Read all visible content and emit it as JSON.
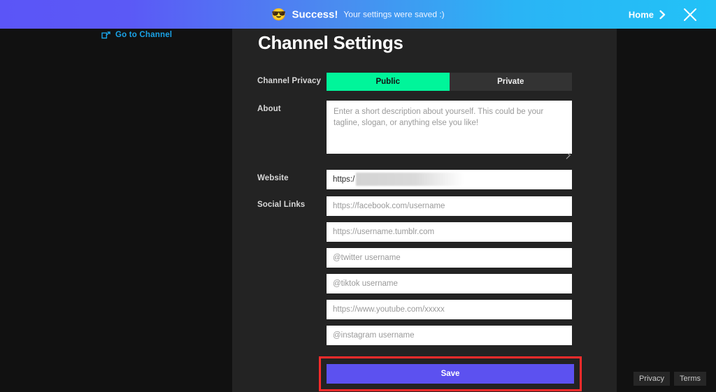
{
  "banner": {
    "emoji": "😎",
    "emoji_name": "sunglasses-face-emoji",
    "strong": "Success!",
    "message": "Your settings were saved :)",
    "home_label": "Home",
    "close_label": "Close",
    "gradient_start": "#5b55f7",
    "gradient_end": "#22c2f7"
  },
  "nav": {
    "go_to_channel": "Go to Channel",
    "link_color": "#1aa3e8"
  },
  "page": {
    "title": "Channel Settings",
    "panel_bg": "#232323",
    "app_bg": "#111111"
  },
  "form": {
    "privacy": {
      "label": "Channel Privacy",
      "options": [
        "Public",
        "Private"
      ],
      "selected": "Public",
      "active_color": "#00f59a",
      "inactive_color": "#333333"
    },
    "about": {
      "label": "About",
      "value": "",
      "placeholder": "Enter a short description about yourself. This could be your tagline, slogan, or anything else you like!"
    },
    "website": {
      "label": "Website",
      "value": "https:/",
      "redacted": true
    },
    "social": {
      "label": "Social Links",
      "fields": [
        {
          "name": "facebook",
          "value": "",
          "placeholder": "https://facebook.com/username"
        },
        {
          "name": "tumblr",
          "value": "",
          "placeholder": "https://username.tumblr.com"
        },
        {
          "name": "twitter",
          "value": "",
          "placeholder": "@twitter username"
        },
        {
          "name": "tiktok",
          "value": "",
          "placeholder": "@tiktok username"
        },
        {
          "name": "youtube",
          "value": "",
          "placeholder": "https://www.youtube.com/xxxxx"
        },
        {
          "name": "instagram",
          "value": "",
          "placeholder": "@instagram username"
        }
      ]
    },
    "save": {
      "label": "Save",
      "color": "#5c51f0",
      "highlight_color": "#fc2b2b"
    }
  },
  "footer": {
    "links": [
      "Privacy",
      "Terms"
    ]
  }
}
